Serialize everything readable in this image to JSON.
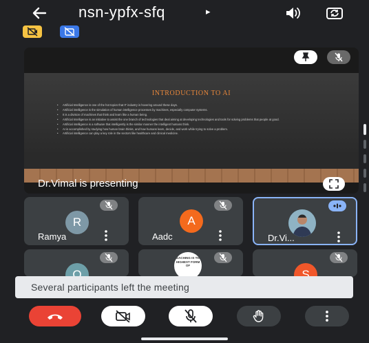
{
  "header": {
    "back_icon": "arrow-left-icon",
    "meeting_code": "nsn-ypfx-sfq",
    "caret": "▸",
    "speaker_icon": "speaker-icon",
    "switch_camera_icon": "camera-switch-icon",
    "chips": [
      {
        "icon": "camera-off-icon",
        "color": "#f6c343"
      },
      {
        "icon": "captions-off-icon",
        "color": "#3b78e7"
      }
    ]
  },
  "presentation": {
    "presenter_label": "Dr.Vimal is presenting",
    "pin_icon": "pin-icon",
    "mic_icon": "mic-off-icon",
    "fullscreen_icon": "fullscreen-icon",
    "slide": {
      "title": "INTRODUCTION TO AI",
      "bullets": [
        "Artificial Intelligence is one of the hot topics that IT industry is hovering around these days.",
        "Artificial intelligence is the simulation of human intelligence processes by machines, especially computer systems.",
        "It is a division of machines that think and learn like a human being.",
        "Artificial Intelligence is an initiative to assist the one branch of technologies that deal aiming at developing technologies and tools for solving problems that people at good.",
        "Artificial intelligence is a software that intelligently is the similar manner the intelligent humans think.",
        "AI is accomplished by studying how human brain thinks, and how humans learn, decide, and work while trying to solve a problem.",
        "Artificial intelligence can play a key role in the sectors like healthcare and clinical medicine."
      ]
    }
  },
  "participants": [
    {
      "name": "Ramya",
      "initial": "R",
      "avatar_color": "#7e98a6",
      "mic": "mic-off-icon"
    },
    {
      "name": "Aadc",
      "initial": "A",
      "avatar_color": "#f46a1d",
      "mic": "mic-off-icon"
    },
    {
      "name": "Dr.Vi...",
      "initial": "",
      "avatar_color": "#4a7a8c",
      "mic": "speaking-indicator-icon"
    },
    {
      "name": "",
      "initial": "O",
      "avatar_color": "#6d9fa8",
      "mic": "mic-off-icon"
    },
    {
      "name": "",
      "initial": "",
      "avatar_color": "#ffffff",
      "mic": "mic-off-icon",
      "thumb_text": "TEACHING IS THE HIGHEST FORM OF"
    },
    {
      "name": "",
      "initial": "S",
      "avatar_color": "#f0572a",
      "mic": "mic-off-icon"
    }
  ],
  "toast": {
    "message": "Several participants left the meeting"
  },
  "controls": [
    {
      "name": "end-call",
      "icon": "phone-hangup-icon",
      "color": "#ea4335"
    },
    {
      "name": "camera",
      "icon": "camera-off-icon",
      "color": "#ffffff"
    },
    {
      "name": "microphone",
      "icon": "mic-off-icon",
      "color": "#ffffff"
    },
    {
      "name": "raise-hand",
      "icon": "hand-icon",
      "color": "#3c4043"
    },
    {
      "name": "more-options",
      "icon": "more-vert-icon",
      "color": "#3c4043"
    }
  ]
}
